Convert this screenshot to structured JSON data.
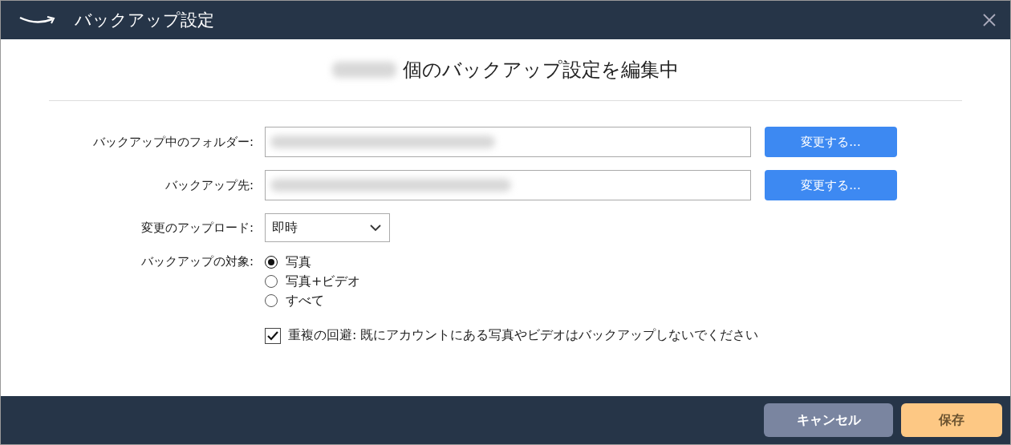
{
  "window": {
    "title": "バックアップ設定"
  },
  "heading": "個のバックアップ設定を編集中",
  "fields": [
    {
      "kind": "path",
      "label": "バックアップ中のフォルダー:",
      "button": "変更する..."
    },
    {
      "kind": "path",
      "label": "バックアップ先:",
      "button": "変更する..."
    },
    {
      "kind": "select",
      "label": "変更のアップロード:",
      "value": "即時"
    },
    {
      "kind": "radio",
      "label": "バックアップの対象:",
      "options": [
        {
          "label": "写真",
          "selected": true
        },
        {
          "label": "写真+ビデオ",
          "selected": false
        },
        {
          "label": "すべて",
          "selected": false
        }
      ]
    }
  ],
  "dedupe": {
    "label": "重複の回避: 既にアカウントにある写真やビデオはバックアップしないでください",
    "checked": true
  },
  "buttons": [
    {
      "kind": "cancel",
      "label": "キャンセル"
    },
    {
      "kind": "save",
      "label": "保存"
    }
  ]
}
